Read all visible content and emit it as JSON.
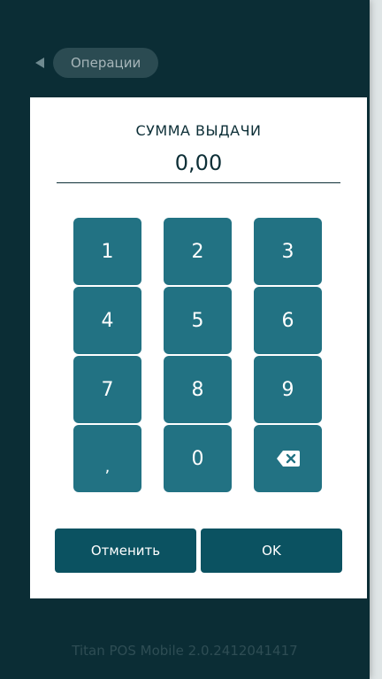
{
  "header": {
    "back_label": "Операции"
  },
  "dialog": {
    "title": "СУММА ВЫДАЧИ",
    "amount": "0,00"
  },
  "keypad": {
    "keys": [
      "1",
      "2",
      "3",
      "4",
      "5",
      "6",
      "7",
      "8",
      "9",
      ",",
      "0"
    ],
    "backspace_icon": "backspace-icon"
  },
  "actions": {
    "cancel_label": "Отменить",
    "ok_label": "OK"
  },
  "footer": {
    "version": "Titan POS Mobile 2.0.2412041417"
  },
  "colors": {
    "background": "#0b2d35",
    "key": "#227283",
    "action_button": "#0b5261",
    "dialog": "#ffffff",
    "text_dark": "#0d2f37"
  }
}
